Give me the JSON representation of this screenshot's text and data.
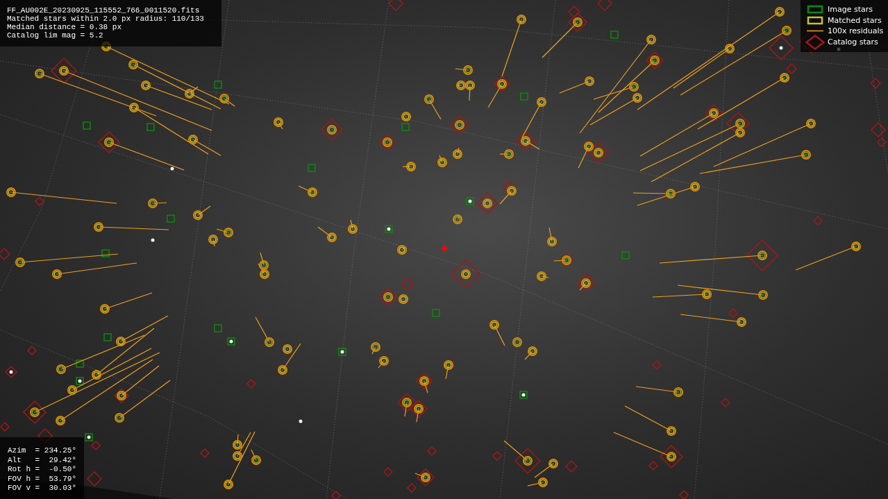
{
  "info_box": {
    "lines": [
      "FF_AU002E_20230925_115552_766_0011520.fits",
      "Matched stars within 2.0 px radius: 110/133",
      "Median distance = 0.38 px",
      "Catalog lim mag = 5.2"
    ]
  },
  "legend": {
    "items": [
      {
        "kind": "image_star",
        "label": "Image stars"
      },
      {
        "kind": "matched_star",
        "label": "Matched stars"
      },
      {
        "kind": "residual",
        "label": "100x residuals"
      },
      {
        "kind": "catalog_star",
        "label": "Catalog stars"
      }
    ]
  },
  "pointing_box": {
    "lines": [
      "Azim  = 234.25°",
      "Alt   =  29.42°",
      "Rot h =  -0.50°",
      "FOV h =  53.79°",
      "FOV v =  30.03°"
    ]
  }
}
